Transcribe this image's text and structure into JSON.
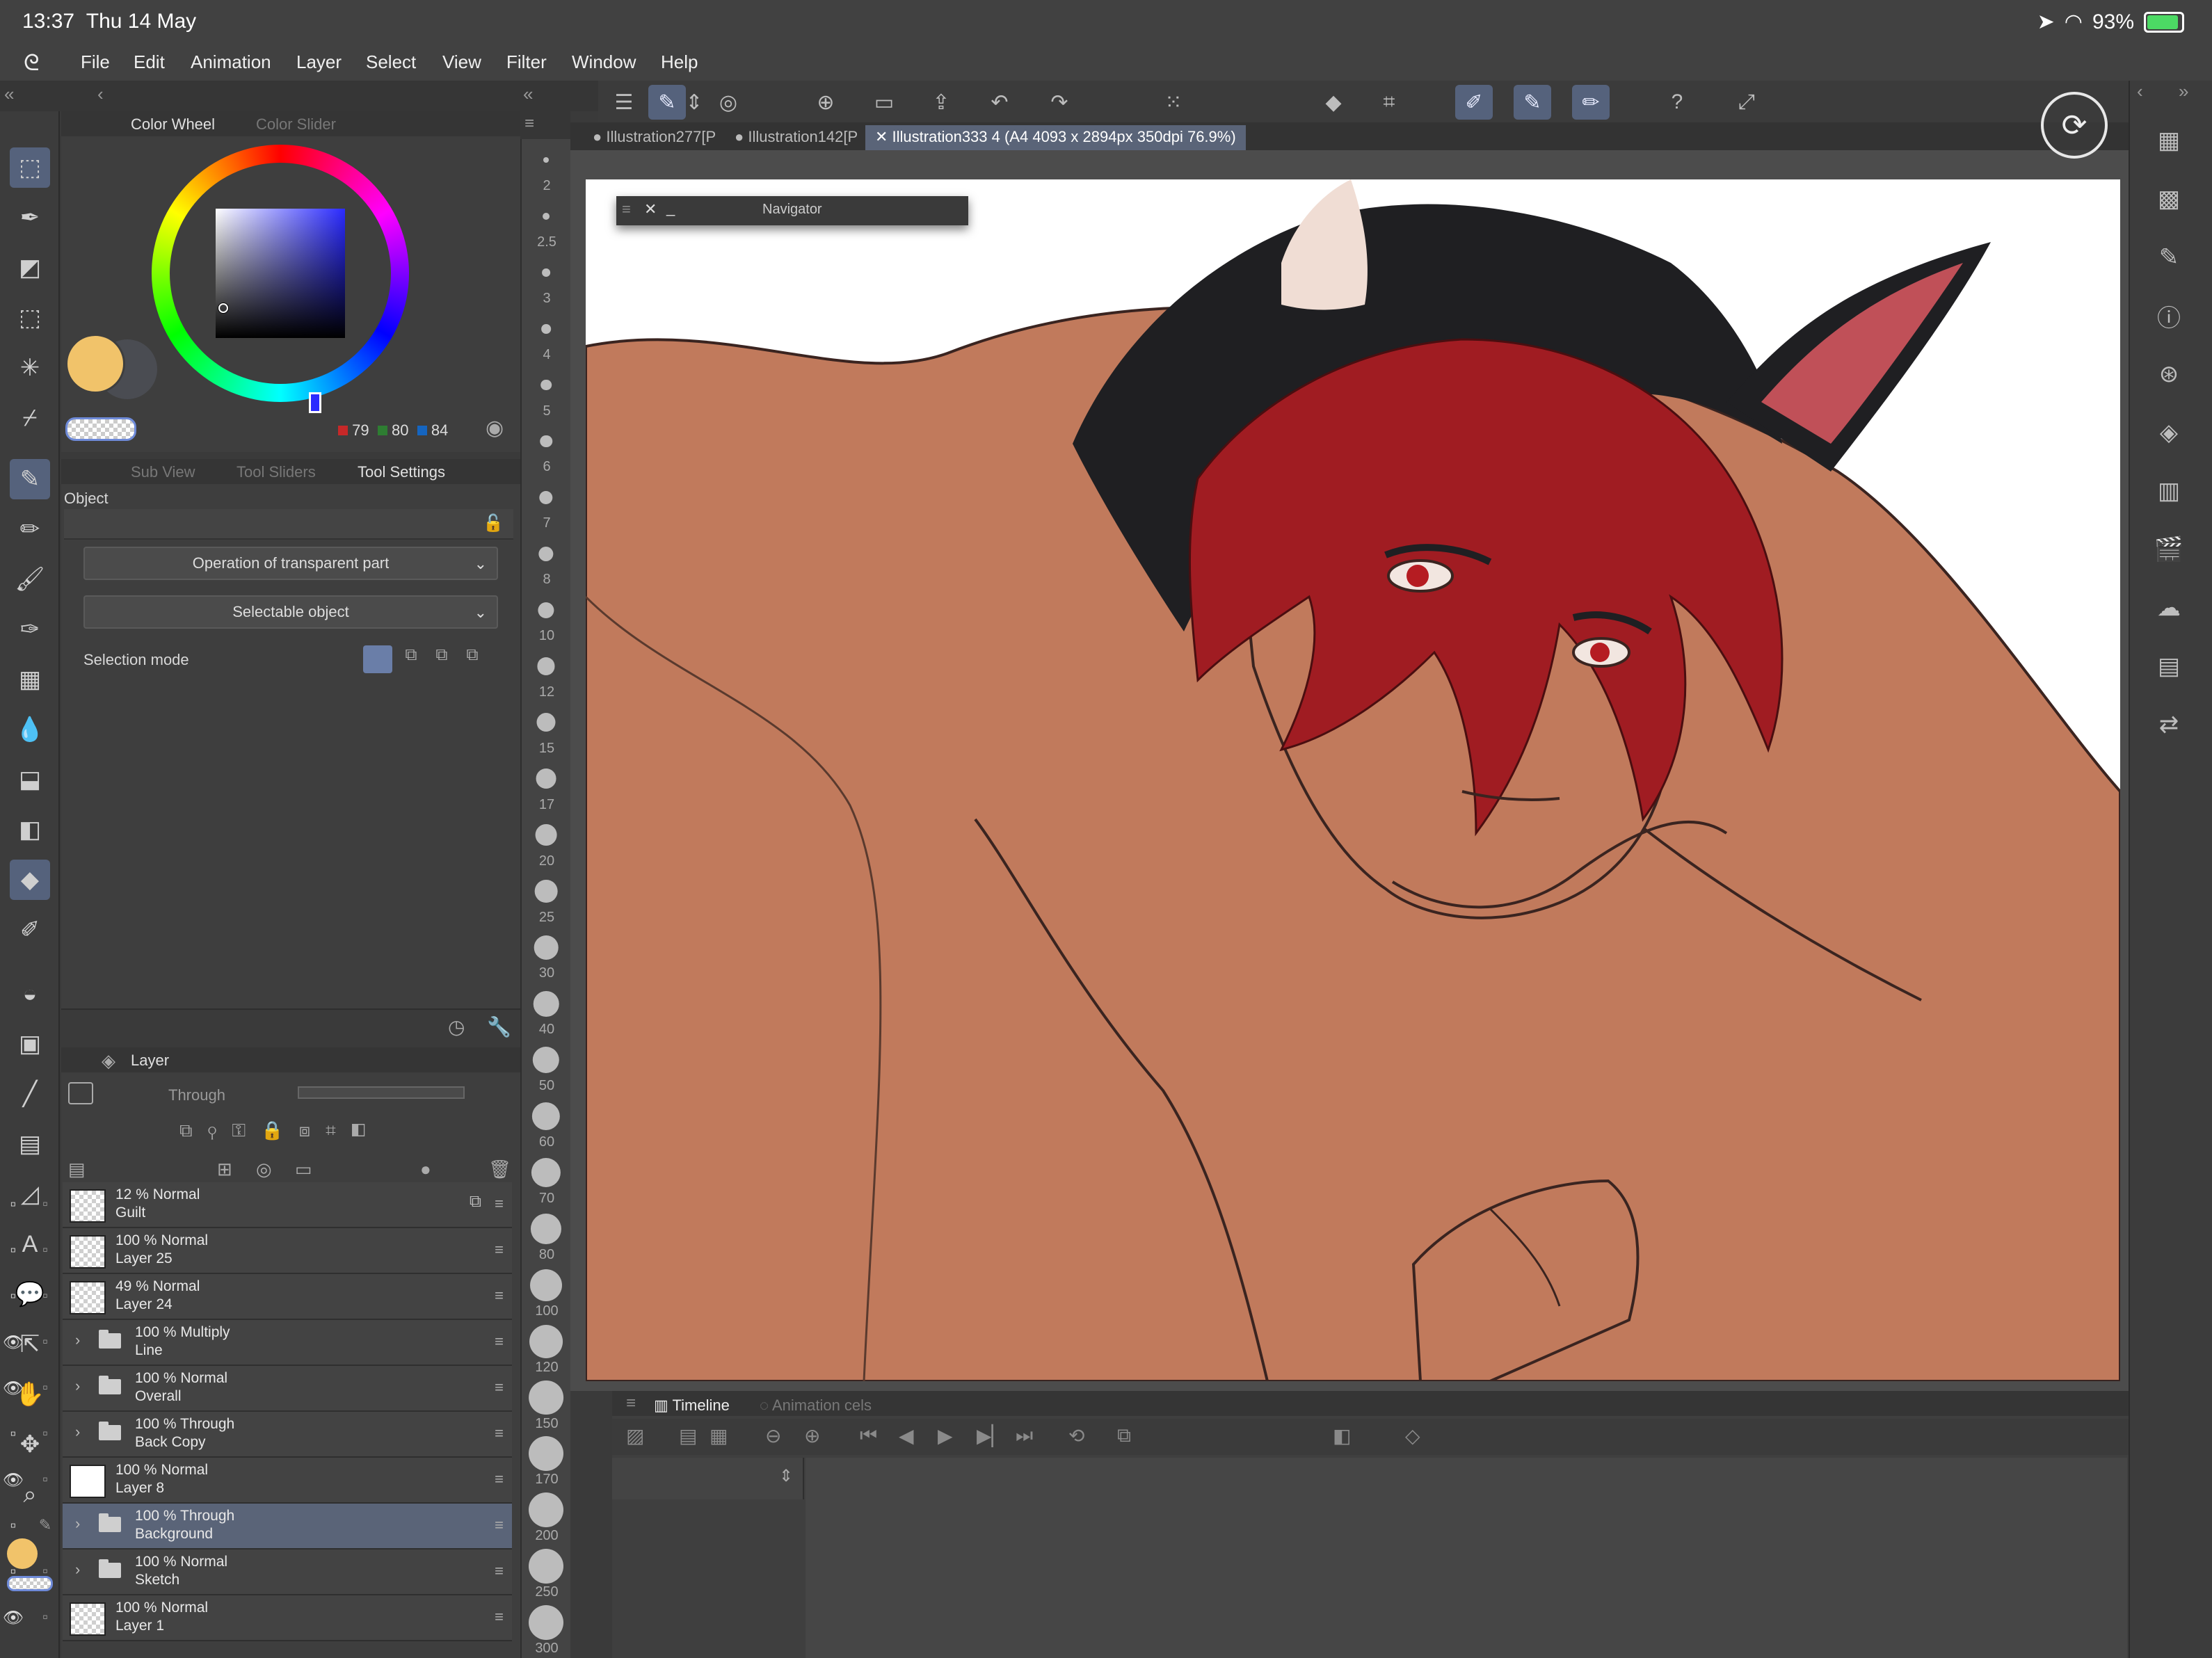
{
  "status_bar": {
    "time": "13:37",
    "date": "Thu 14 May",
    "battery": "93%"
  },
  "menu": [
    "File",
    "Edit",
    "Animation",
    "Layer",
    "Select",
    "View",
    "Filter",
    "Window",
    "Help"
  ],
  "color_panel": {
    "tab_active": "Color Wheel",
    "tab_inactive": "Color Slider",
    "r": "79",
    "g": "80",
    "b": "84",
    "main_color": "#f1c36a",
    "sub_color": "#4a4c52"
  },
  "tool_settings": {
    "tabs": [
      "Sub View",
      "Tool Sliders",
      "Tool Settings"
    ],
    "title": "Object",
    "dropdown1": "Operation of transparent part",
    "dropdown2": "Selectable object",
    "selection_mode_label": "Selection mode"
  },
  "layer_panel": {
    "title": "Layer",
    "blend_mode": "Through",
    "layers": [
      {
        "blend": "12 %  Normal",
        "name": "Guilt",
        "eye": false,
        "type": "raster"
      },
      {
        "blend": "100 %  Normal",
        "name": "Layer 25",
        "eye": false,
        "type": "raster"
      },
      {
        "blend": "49 %  Normal",
        "name": "Layer 24",
        "eye": false,
        "type": "raster"
      },
      {
        "blend": "100 %  Multiply",
        "name": "Line",
        "eye": true,
        "type": "folder"
      },
      {
        "blend": "100 %  Normal",
        "name": "Overall",
        "eye": true,
        "type": "folder"
      },
      {
        "blend": "100 %  Through",
        "name": "Back Copy",
        "eye": false,
        "type": "folder"
      },
      {
        "blend": "100 %  Normal",
        "name": "Layer 8",
        "eye": true,
        "type": "raster"
      },
      {
        "blend": "100 %  Through",
        "name": "Background",
        "eye": false,
        "type": "folder",
        "selected": true
      },
      {
        "blend": "100 %  Normal",
        "name": "Sketch",
        "eye": false,
        "type": "folder"
      },
      {
        "blend": "100 %  Normal",
        "name": "Layer 1",
        "eye": true,
        "type": "raster"
      }
    ]
  },
  "brush_sizes": [
    "2",
    "2.5",
    "3",
    "4",
    "5",
    "6",
    "7",
    "8",
    "10",
    "12",
    "15",
    "17",
    "20",
    "25",
    "30",
    "40",
    "50",
    "60",
    "70",
    "80",
    "100",
    "120",
    "150",
    "170",
    "200",
    "250",
    "300"
  ],
  "doc_tabs": [
    "Illustration277[P",
    "Illustration142[P",
    "Illustration333 4 (A4 4093 x 2894px 350dpi 76.9%)"
  ],
  "navigator": {
    "title": "Navigator"
  },
  "timeline": {
    "tab_active": "Timeline",
    "tab_inactive": "Animation cels"
  }
}
